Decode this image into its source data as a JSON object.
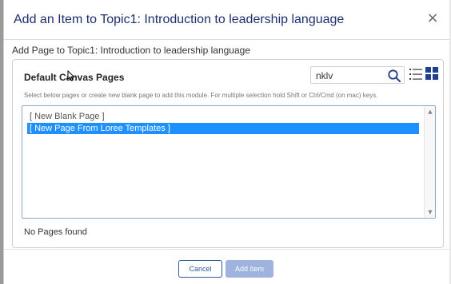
{
  "modal": {
    "title": "Add an Item to Topic1: Introduction to leadership language",
    "close_symbol": "×",
    "subtitle": "Add Page to Topic1: Introduction to leadership language"
  },
  "panel": {
    "title": "Default Canvas Pages",
    "search_value": "nklv",
    "instruction": "Select below pages or create new blank page to add this module. For multiple selection hold Shift or Ctrl/Cmd (on mac) keys.",
    "options": [
      {
        "label": "[ New Blank Page ]",
        "selected": false
      },
      {
        "label": "[ New Page From Loree Templates ]",
        "selected": true
      }
    ],
    "empty_message": "No Pages found"
  },
  "footer": {
    "cancel_label": "Cancel",
    "add_label": "Add Item"
  },
  "colors": {
    "title": "#1f2f6e",
    "selection": "#1e90ff",
    "primary": "#2d5aa0",
    "disabled_primary": "#9fb3df"
  },
  "icons": {
    "search": "search-icon",
    "list_view": "list-view-icon",
    "grid_view": "grid-view-icon",
    "close": "close-icon",
    "cursor": "pointer-cursor-icon"
  }
}
